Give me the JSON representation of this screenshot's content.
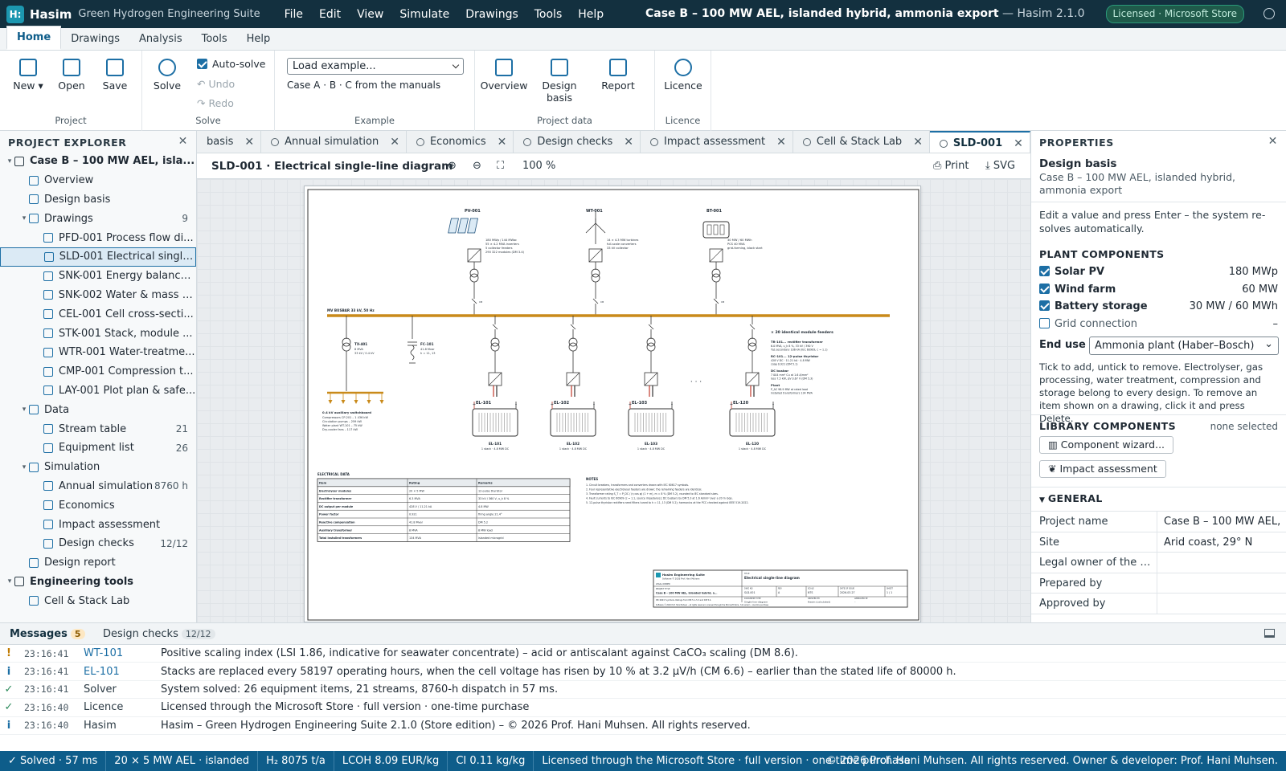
{
  "titlebar": {
    "app_name": "Hasim",
    "app_subtitle": "Green Hydrogen Engineering Suite",
    "menu": [
      "File",
      "Edit",
      "View",
      "Simulate",
      "Drawings",
      "Tools",
      "Help"
    ],
    "window_title": "Case B – 100 MW AEL, islanded hybrid, ammonia export",
    "window_suffix": "— Hasim 2.1.0",
    "licence_badge": "Licensed · Microsoft Store"
  },
  "ribbon_tabs": [
    "Home",
    "Drawings",
    "Analysis",
    "Tools",
    "Help"
  ],
  "ribbon": {
    "project": {
      "label": "Project",
      "new": "New ▾",
      "open": "Open",
      "save": "Save"
    },
    "solve": {
      "label": "Solve",
      "solve": "Solve",
      "autosolve": "Auto-solve",
      "undo": "Undo",
      "redo": "Redo"
    },
    "example": {
      "label": "Example",
      "select": "Load example...",
      "hint": "Case A · B · C from the manuals"
    },
    "project_data": {
      "label": "Project data",
      "overview": "Overview",
      "design_basis_1": "Design",
      "design_basis_2": "basis",
      "report": "Report"
    },
    "licence": {
      "label": "Licence",
      "licence": "Licence"
    }
  },
  "explorer": {
    "title": "PROJECT EXPLORER",
    "items": [
      {
        "label": "Case B – 100 MW AEL, isla...",
        "indent": 0,
        "twisty": "▾",
        "bold": true,
        "count": ""
      },
      {
        "label": "Overview",
        "indent": 1,
        "twisty": "",
        "count": ""
      },
      {
        "label": "Design basis",
        "indent": 1,
        "twisty": "",
        "count": ""
      },
      {
        "label": "Drawings",
        "indent": 1,
        "twisty": "▾",
        "count": "9"
      },
      {
        "label": "PFD-001 Process flow di...",
        "indent": 2,
        "twisty": "",
        "count": ""
      },
      {
        "label": "SLD-001 Electrical single...",
        "indent": 2,
        "twisty": "",
        "count": "",
        "selected": true
      },
      {
        "label": "SNK-001 Energy balance...",
        "indent": 2,
        "twisty": "",
        "count": ""
      },
      {
        "label": "SNK-002 Water & mass b...",
        "indent": 2,
        "twisty": "",
        "count": ""
      },
      {
        "label": "CEL-001 Cell cross-secti...",
        "indent": 2,
        "twisty": "",
        "count": ""
      },
      {
        "label": "STK-001 Stack, module ...",
        "indent": 2,
        "twisty": "",
        "count": ""
      },
      {
        "label": "WTR-001 Water-treatme...",
        "indent": 2,
        "twisty": "",
        "count": ""
      },
      {
        "label": "CMP-001 Compression t...",
        "indent": 2,
        "twisty": "",
        "count": ""
      },
      {
        "label": "LAY-001 Plot plan & safe...",
        "indent": 2,
        "twisty": "",
        "count": ""
      },
      {
        "label": "Data",
        "indent": 1,
        "twisty": "▾",
        "count": ""
      },
      {
        "label": "Stream table",
        "indent": 2,
        "twisty": "",
        "count": "21"
      },
      {
        "label": "Equipment list",
        "indent": 2,
        "twisty": "",
        "count": "26"
      },
      {
        "label": "Simulation",
        "indent": 1,
        "twisty": "▾",
        "count": ""
      },
      {
        "label": "Annual simulation",
        "indent": 2,
        "twisty": "",
        "count": "8760 h"
      },
      {
        "label": "Economics",
        "indent": 2,
        "twisty": "",
        "count": ""
      },
      {
        "label": "Impact assessment",
        "indent": 2,
        "twisty": "",
        "count": ""
      },
      {
        "label": "Design checks",
        "indent": 2,
        "twisty": "",
        "count": "12/12"
      },
      {
        "label": "Design report",
        "indent": 1,
        "twisty": "",
        "count": ""
      },
      {
        "label": "Engineering tools",
        "indent": 0,
        "twisty": "▾",
        "bold": true,
        "count": ""
      },
      {
        "label": "Cell & Stack Lab",
        "indent": 1,
        "twisty": "",
        "count": ""
      }
    ]
  },
  "doc_tabs": [
    {
      "label": "basis",
      "active": false
    },
    {
      "label": "Annual simulation",
      "active": false
    },
    {
      "label": "Economics",
      "active": false
    },
    {
      "label": "Design checks",
      "active": false
    },
    {
      "label": "Impact assessment",
      "active": false
    },
    {
      "label": "Cell & Stack Lab",
      "active": false
    },
    {
      "label": "SLD-001",
      "active": true
    }
  ],
  "drawing": {
    "title": "SLD-001 · Electrical single-line diagram",
    "zoom": "100 %",
    "print": "Print",
    "svg": "SVG",
    "sources": [
      {
        "tag": "PV-001",
        "lines": [
          "180 MWp / 144 MWac",
          "55 × 4.2 MVA inverters",
          "5 collector feeders",
          "290 322 modules (DM 3.4)"
        ]
      },
      {
        "tag": "WT-001",
        "lines": [
          "14 × 4.3 MW turbines",
          "full-scale converters",
          "33 kV collector"
        ]
      },
      {
        "tag": "BT-001",
        "lines": [
          "30 MW / 60 MWh",
          "PCS 40 MVA",
          "grid-forming, black start"
        ]
      }
    ],
    "cb": "CB",
    "busbar": "MV BUSBAR 33 kV, 50 Hz",
    "tx401": {
      "tag": "TX-401",
      "lines": [
        "8 MVA",
        "33 kV / 0.4 kV"
      ]
    },
    "fc101": {
      "tag": "FC-101",
      "lines": [
        "41.8 Mvar",
        "h = 11, 13"
      ]
    },
    "aux": {
      "title": "0.4 kV auxiliary switchboard",
      "lines": [
        "Compressors CP-201 – 1 436 kW",
        "Circulation pumps – 259 kW",
        "Water plant WT-101 – 75 kW",
        "Dry-cooler fans – 117 kW"
      ]
    },
    "electrolysers": [
      {
        "tag": "EL-101",
        "sub": "1 stack · 4.8 MW DC"
      },
      {
        "tag": "EL-102",
        "sub": "1 stack · 4.8 MW DC"
      },
      {
        "tag": "EL-103",
        "sub": "1 stack · 4.8 MW DC"
      },
      {
        "tag": "EL-120",
        "sub": "1 stack · 4.8 MW DC"
      }
    ],
    "dots": "· · ·",
    "module_note": {
      "title": "× 20 identical module feeders",
      "blocks": [
        {
          "h": "TR-101... rectifier transformer",
          "lines": [
            "6.0 MVA, u_k 8 %, 33 kV / 390 V",
            "Y/Δ secondary 106 kA (IEC 60909, c = 1.1)"
          ]
        },
        {
          "h": "RC-101... 12-pulse thyristor",
          "lines": [
            "428 V DC · 11.21 kA · 4.8 MW",
            "cosφ 0.921 (DM 5.1)"
          ]
        },
        {
          "h": "DC busbar",
          "lines": [
            "7 004 mm² Cu at 1.6 A/mm²",
            "loss 7.5 kW, ΔV 0.67 V (DM 5.3)"
          ]
        },
        {
          "h": "Plant",
          "lines": [
            "P_AC 98.9 MW at rated load",
            "installed transformers 134 MVA"
          ]
        }
      ]
    },
    "elec_table": {
      "title": "ELECTRICAL DATA",
      "headers": [
        "Item",
        "Rating",
        "Remarks"
      ],
      "rows": [
        [
          "Electrolyser modules",
          "20 × 5 MW",
          "12-pulse thyristor"
        ],
        [
          "Rectifier transformer",
          "6.3 MVA",
          "33 kV / 360 V, u_k 8 %"
        ],
        [
          "DC output per module",
          "428 V / 11.21 kA",
          "4.8 MW"
        ],
        [
          "Power factor",
          "0.921",
          "firing angle 21.4°"
        ],
        [
          "Reactive compensation",
          "41.8 Mvar",
          "DM 5.2"
        ],
        [
          "Auxiliary transformer",
          "8 MVA",
          "8 MW load"
        ],
        [
          "Total installed transformers",
          "134 MVA",
          "islanded microgrid"
        ]
      ]
    },
    "notes": {
      "title": "NOTES",
      "lines": [
        "1. Circuit breakers, transformers and converters drawn with IEC 60617 symbols.",
        "2. Four representative electrolyser feeders are drawn; the remaining feeders are identical.",
        "3. Transformer rating S_T = P_DC / (η cos φ) (1 + m), m = 8 % (DM 5.2), rounded to IEC standard sizes.",
        "4. Fault currents to IEC 60909 (c = 1.1, source impedance); DC busbars by DM 5.3 at 1.6 A/mm² over a 20 m loop.",
        "5. 12-pulse thyristor rectifiers need filters tuned to h = 11, 13 (DM 5.2); harmonics at the PCC checked against IEEE 519-2022."
      ]
    },
    "titleblock": {
      "company": "Hasim Engineering Suite",
      "company_sub": "Software © 2026 Prof. Hani Muhsen",
      "title_label": "TITLE",
      "title": "Electrical single-line diagram",
      "doc_label": "DWG NO",
      "doc_no": "SLD-001",
      "rev_label": "REV",
      "rev": "A",
      "scale_label": "SCALE",
      "scale": "NTS",
      "date_label": "DATE OF ISSUE",
      "date": "2026-03-27",
      "sheet_label": "SHEET",
      "sheet": "1 / 1",
      "project_label": "PROJECT TITLE",
      "project": "Case B – 100 MW AEL, islanded hybrid, a...",
      "doctype_label": "DOCUMENT TYPE",
      "doctype": "Single-line diagram",
      "created_label": "CREATED BY",
      "created": "Hasim (calculated)",
      "approved_label": "APPROVED BY",
      "approved": "–",
      "level_label": "LEGAL OWNER",
      "footer1": "IEC 60617 symbols. Ratings from DM 5.1–5.3 and DM 5.4.",
      "footer2": "Software © 2026 Prof. Hani Muhsen – all rights reserved. Licensed through the Microsoft Store · full version · one-time purchase"
    }
  },
  "properties": {
    "title": "PROPERTIES",
    "heading": "Design basis",
    "subheading": "Case B – 100 MW AEL, islanded hybrid, ammonia export",
    "hint": "Edit a value and press Enter – the system re-solves automatically.",
    "plant_title": "PLANT COMPONENTS",
    "plant": [
      {
        "label": "Solar PV",
        "value": "180 MWp",
        "checked": true
      },
      {
        "label": "Wind farm",
        "value": "60 MW",
        "checked": true
      },
      {
        "label": "Battery storage",
        "value": "30 MW / 60 MWh",
        "checked": true
      },
      {
        "label": "Grid connection",
        "value": "–",
        "checked": false
      }
    ],
    "end_use_label": "End use",
    "end_use_value": "Ammonia plant (Haber–Bosch)",
    "tick_hint": "Tick to add, untick to remove. Electrolyser, gas processing, water treatment, compression and storage belong to every design. To remove an item shown on a drawing, click it and press Delete.",
    "library_title": "LIBRARY COMPONENTS",
    "library_status": "none selected",
    "wizard_btn": "Component wizard...",
    "impact_btn": "Impact assessment",
    "general_title": "GENERAL",
    "general": [
      {
        "k": "Project name",
        "v": "Case B – 100 MW AEL,"
      },
      {
        "k": "Site",
        "v": "Arid coast, 29° N"
      },
      {
        "k": "Legal owner of the d...",
        "v": ""
      },
      {
        "k": "Prepared by",
        "v": ""
      },
      {
        "k": "Approved by",
        "v": ""
      }
    ]
  },
  "messages": {
    "tab_messages": "Messages",
    "messages_count": "5",
    "tab_checks": "Design checks",
    "checks_count": "12/12",
    "rows": [
      {
        "kind": "!",
        "color": "#c07a00",
        "time": "23:16:41",
        "src": "WT-101",
        "src_link": true,
        "msg": "Positive scaling index (LSI 1.86, indicative for seawater concentrate) – acid or antiscalant against CaCO₃ scaling (DM 8.6)."
      },
      {
        "kind": "i",
        "color": "#1d6fa5",
        "time": "23:16:41",
        "src": "EL-101",
        "src_link": true,
        "msg": "Stacks are replaced every 58197 operating hours, when the cell voltage has risen by 10 % at 3.2 μV/h (CM 6.6) – earlier than the stated life of 80000 h."
      },
      {
        "kind": "✓",
        "color": "#2a8a5a",
        "time": "23:16:41",
        "src": "Solver",
        "src_link": false,
        "msg": "System solved: 26 equipment items, 21 streams, 8760-h dispatch in 57 ms."
      },
      {
        "kind": "✓",
        "color": "#2a8a5a",
        "time": "23:16:40",
        "src": "Licence",
        "src_link": false,
        "msg": "Licensed through the Microsoft Store · full version · one-time purchase"
      },
      {
        "kind": "i",
        "color": "#1d6fa5",
        "time": "23:16:40",
        "src": "Hasim",
        "src_link": false,
        "msg": "Hasim – Green Hydrogen Engineering Suite 2.1.0 (Store edition) – © 2026 Prof. Hani Muhsen. All rights reserved."
      }
    ]
  },
  "statusbar": {
    "cells": [
      "✓ Solved · 57 ms",
      "20 × 5 MW AEL · islanded",
      "H₂ 8075 t/a",
      "LCOH 8.09 EUR/kg",
      "CI 0.11 kg/kg",
      "Licensed through the Microsoft Store · full version · one-time purchase"
    ],
    "copyright": "© 2026 Prof. Hani Muhsen. All rights reserved. Owner & developer: Prof. Hani Muhsen."
  },
  "colors": {
    "accent": "#1d6fa5",
    "titlebar": "#13303f",
    "busbar": "#c98a1a",
    "status": "#0e5d8a"
  }
}
